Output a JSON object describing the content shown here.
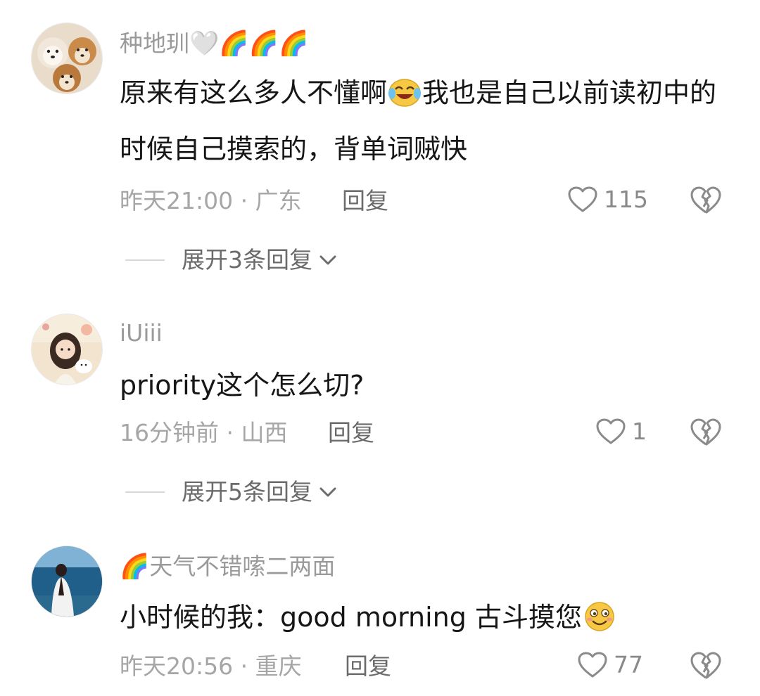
{
  "comments": [
    {
      "username": "种地玔",
      "username_suffix": "🤍🌈🌈🌈",
      "text_part1": "原来有这么多人不懂啊",
      "emoji": "crying-laughing-emoji",
      "text_part2": "我也是自己以前读初中的时候自己摸索的，背单词贼快",
      "time": "昨天21:00",
      "location": "广东",
      "meta_sep": " · ",
      "reply_label": "回复",
      "likes": "115",
      "expand_label": "展开3条回复"
    },
    {
      "username": "iUiii",
      "text": "priority这个怎么切?",
      "time": "16分钟前",
      "location": "山西",
      "meta_sep": " · ",
      "reply_label": "回复",
      "likes": "1",
      "expand_label": "展开5条回复"
    },
    {
      "username_prefix": "🌈",
      "username": "天气不错嗦二两面",
      "text": "小时候的我：good morning 古斗摸您",
      "emoji": "smirk-emoji",
      "time": "昨天20:56",
      "location": "重庆",
      "meta_sep": " · ",
      "reply_label": "回复",
      "likes": "77"
    }
  ],
  "colors": {
    "username": "#9a9a9a",
    "text": "#161616",
    "meta": "#a6a6a6",
    "reply": "#6b6b6b",
    "icon": "#8a8a8a"
  }
}
